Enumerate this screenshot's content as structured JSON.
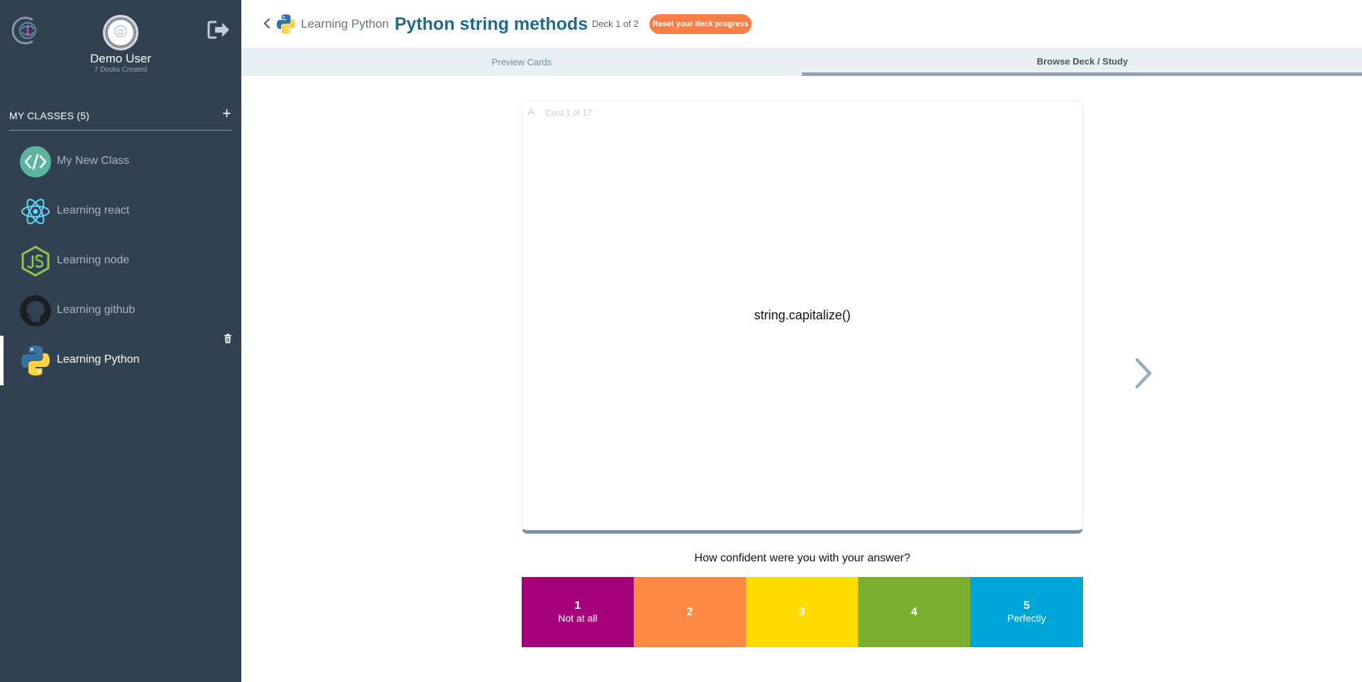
{
  "user": {
    "name": "Demo User",
    "decks_created": "7 Decks Created"
  },
  "sidebar": {
    "classes_title": "MY CLASSES (5)",
    "add_symbol": "+",
    "items": [
      {
        "label": "My New Class",
        "icon": "code-icon"
      },
      {
        "label": "Learning react",
        "icon": "react-icon"
      },
      {
        "label": "Learning node",
        "icon": "nodejs-icon"
      },
      {
        "label": "Learning github",
        "icon": "github-icon"
      },
      {
        "label": "Learning Python",
        "icon": "python-icon",
        "active": true
      }
    ]
  },
  "header": {
    "class_name": "Learning Python",
    "deck_title": "Python string methods",
    "deck_position": "Deck 1 of 2",
    "reset_label": "Reset your deck progress"
  },
  "tabs": {
    "preview": "Preview Cards",
    "browse": "Browse Deck / Study"
  },
  "card": {
    "side": "A",
    "counter": "Card 1 of 17",
    "text": "string.capitalize()"
  },
  "confidence": {
    "question": "How confident were you with your answer?",
    "ratings": [
      {
        "num": "1",
        "label": "Not at all"
      },
      {
        "num": "2",
        "label": ""
      },
      {
        "num": "3",
        "label": ""
      },
      {
        "num": "4",
        "label": ""
      },
      {
        "num": "5",
        "label": "Perfectly"
      }
    ]
  },
  "colors": {
    "sidebar_bg": "#324152",
    "title": "#1f6b8e",
    "reset": "#ff7e45",
    "rating_1": "#a3007a",
    "rating_2": "#ff8843",
    "rating_3": "#ffdc00",
    "rating_4": "#7cae2f",
    "rating_5": "#00a5d8"
  }
}
